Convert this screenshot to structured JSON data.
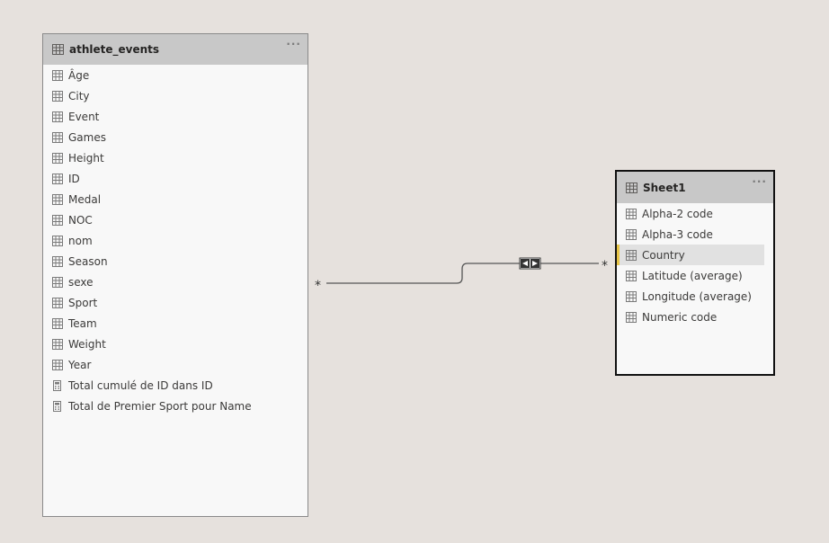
{
  "tables": [
    {
      "name": "athlete_events",
      "more_label": "···",
      "fields": [
        {
          "label": "Âge",
          "kind": "column"
        },
        {
          "label": "City",
          "kind": "column"
        },
        {
          "label": "Event",
          "kind": "column"
        },
        {
          "label": "Games",
          "kind": "column"
        },
        {
          "label": "Height",
          "kind": "column"
        },
        {
          "label": "ID",
          "kind": "column"
        },
        {
          "label": "Medal",
          "kind": "column"
        },
        {
          "label": "NOC",
          "kind": "column"
        },
        {
          "label": "nom",
          "kind": "column"
        },
        {
          "label": "Season",
          "kind": "column"
        },
        {
          "label": "sexe",
          "kind": "column"
        },
        {
          "label": "Sport",
          "kind": "column"
        },
        {
          "label": "Team",
          "kind": "column"
        },
        {
          "label": "Weight",
          "kind": "column"
        },
        {
          "label": "Year",
          "kind": "column"
        },
        {
          "label": "Total cumulé de ID dans ID",
          "kind": "measure"
        },
        {
          "label": "Total de Premier Sport pour Name",
          "kind": "measure"
        }
      ]
    },
    {
      "name": "Sheet1",
      "more_label": "···",
      "selected": true,
      "fields": [
        {
          "label": "Alpha-2 code",
          "kind": "column"
        },
        {
          "label": "Alpha-3 code",
          "kind": "column"
        },
        {
          "label": "Country",
          "kind": "column",
          "highlighted": true
        },
        {
          "label": "Latitude (average)",
          "kind": "column"
        },
        {
          "label": "Longitude (average)",
          "kind": "column"
        },
        {
          "label": "Numeric code",
          "kind": "column"
        }
      ]
    }
  ],
  "relationship": {
    "from_cardinality": "*",
    "to_cardinality": "*",
    "cross_filter": "both",
    "icon": "bidirectional-arrows-icon"
  },
  "colors": {
    "canvas": "#e6e1dd",
    "header": "#c8c8c8",
    "highlight_accent": "#e8c547",
    "line": "#555555"
  }
}
